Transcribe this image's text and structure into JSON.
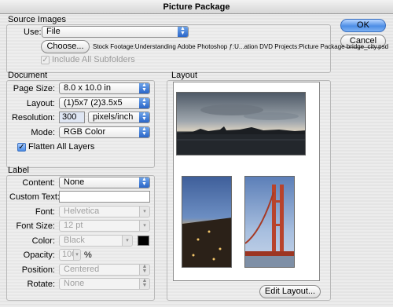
{
  "window": {
    "title": "Picture Package"
  },
  "buttons": {
    "ok": "OK",
    "cancel": "Cancel",
    "choose": "Choose...",
    "edit_layout": "Edit Layout..."
  },
  "source": {
    "group_label": "Source Images",
    "use_label": "Use:",
    "use_value": "File",
    "path": "Stock Footage:Understanding Adobe Photoshop ƒ:U...ation DVD Projects:Picture Package bridge_city.psd",
    "include_subfolders": "Include All Subfolders"
  },
  "document": {
    "group_label": "Document",
    "page_size_label": "Page Size:",
    "page_size_value": "8.0 x 10.0 in",
    "layout_label": "Layout:",
    "layout_value": "(1)5x7 (2)3.5x5",
    "resolution_label": "Resolution:",
    "resolution_value": "300",
    "resolution_unit": "pixels/inch",
    "mode_label": "Mode:",
    "mode_value": "RGB Color",
    "flatten_label": "Flatten All Layers"
  },
  "label": {
    "group_label": "Label",
    "content_label": "Content:",
    "content_value": "None",
    "custom_text_label": "Custom Text:",
    "custom_text_value": "",
    "font_label": "Font:",
    "font_value": "Helvetica",
    "font_size_label": "Font Size:",
    "font_size_value": "12 pt",
    "color_label": "Color:",
    "color_value": "Black",
    "opacity_label": "Opacity:",
    "opacity_value": "100",
    "opacity_unit": "%",
    "position_label": "Position:",
    "position_value": "Centered",
    "rotate_label": "Rotate:",
    "rotate_value": "None"
  },
  "layout_panel": {
    "group_label": "Layout"
  },
  "colors": {
    "label_color_swatch": "#000000"
  }
}
